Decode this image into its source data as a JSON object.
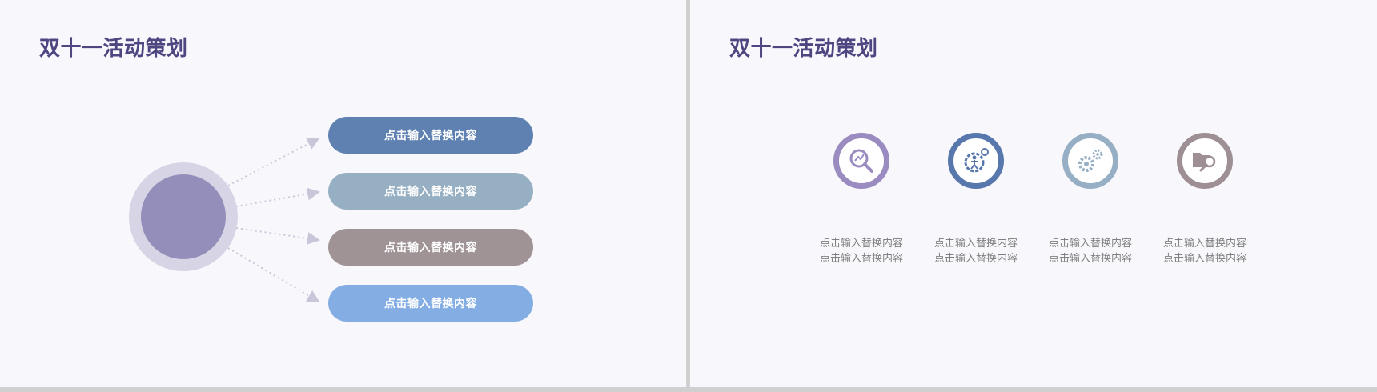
{
  "left_slide": {
    "title": "双十一活动策划",
    "items": [
      {
        "label": "点击输入替换内容",
        "color": "#5e81b1"
      },
      {
        "label": "点击输入替换内容",
        "color": "#97afc2"
      },
      {
        "label": "点击输入替换内容",
        "color": "#9f9396"
      },
      {
        "label": "点击输入替换内容",
        "color": "#84aee3"
      }
    ],
    "hub": {
      "outer_color": "#d7d4e6",
      "inner_color": "#948eba"
    }
  },
  "right_slide": {
    "title": "双十一活动策划",
    "steps": [
      {
        "icon": "magnifier-chart-icon",
        "color": "#9a8cc0",
        "lines": [
          "点击输入替换内容",
          "点击输入替换内容"
        ]
      },
      {
        "icon": "person-gear-icon",
        "color": "#5878ad",
        "lines": [
          "点击输入替换内容",
          "点击输入替换内容"
        ]
      },
      {
        "icon": "gears-icon",
        "color": "#97afc4",
        "lines": [
          "点击输入替换内容",
          "点击输入替换内容"
        ]
      },
      {
        "icon": "folder-search-icon",
        "color": "#9d8f93",
        "lines": [
          "点击输入替换内容",
          "点击输入替换内容"
        ]
      }
    ]
  }
}
